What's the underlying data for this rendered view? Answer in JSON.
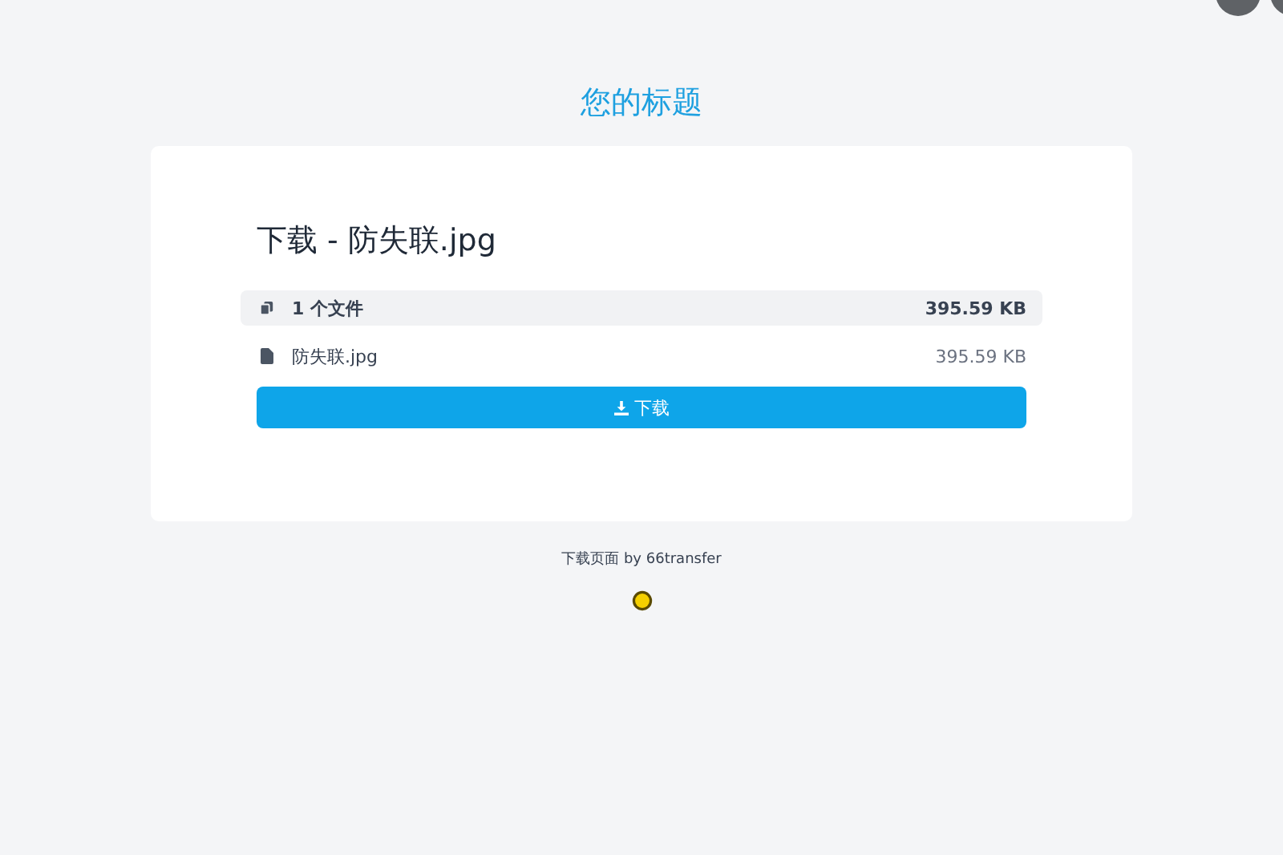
{
  "page_title": "您的标题",
  "card": {
    "heading": "下载 - 防失联.jpg",
    "summary": {
      "count": "1 个文件",
      "size": "395.59 KB"
    },
    "files": [
      {
        "name": "防失联.jpg",
        "size": "395.59 KB"
      }
    ],
    "download_button": "下载"
  },
  "footer": {
    "text": "下载页面",
    "credit": "by 66transfer"
  }
}
